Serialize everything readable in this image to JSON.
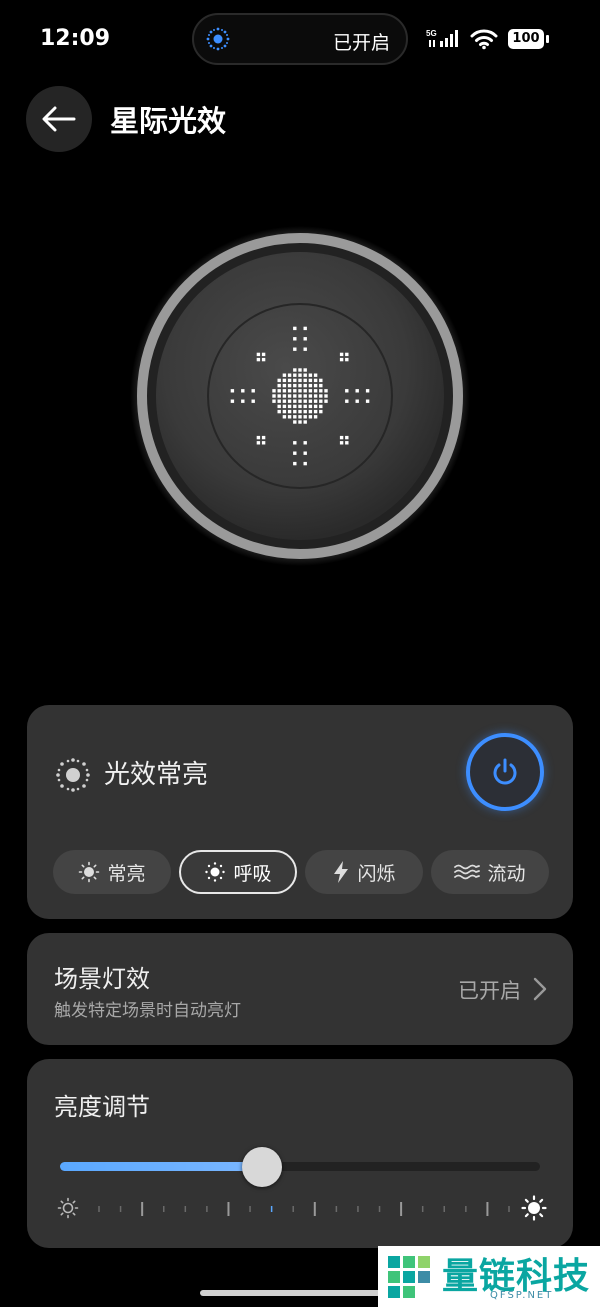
{
  "status_bar": {
    "time": "12:09",
    "island_text": "已开启",
    "network": "5G",
    "battery": "100"
  },
  "header": {
    "title": "星际光效"
  },
  "mode_card": {
    "title": "光效常亮",
    "power_on": true,
    "accent_color": "#3d8eff",
    "modes": [
      {
        "label": "常亮",
        "icon": "sun-icon",
        "active": false
      },
      {
        "label": "呼吸",
        "icon": "dot-sun-icon",
        "active": true
      },
      {
        "label": "闪烁",
        "icon": "lightning-icon",
        "active": false
      },
      {
        "label": "流动",
        "icon": "waves-icon",
        "active": false
      }
    ]
  },
  "scene_card": {
    "title": "场景灯效",
    "subtitle": "触发特定场景时自动亮灯",
    "status": "已开启"
  },
  "brightness_card": {
    "title": "亮度调节",
    "level": 0.42
  },
  "watermark": {
    "text": "量链科技",
    "sub": "QFSP.NET"
  }
}
